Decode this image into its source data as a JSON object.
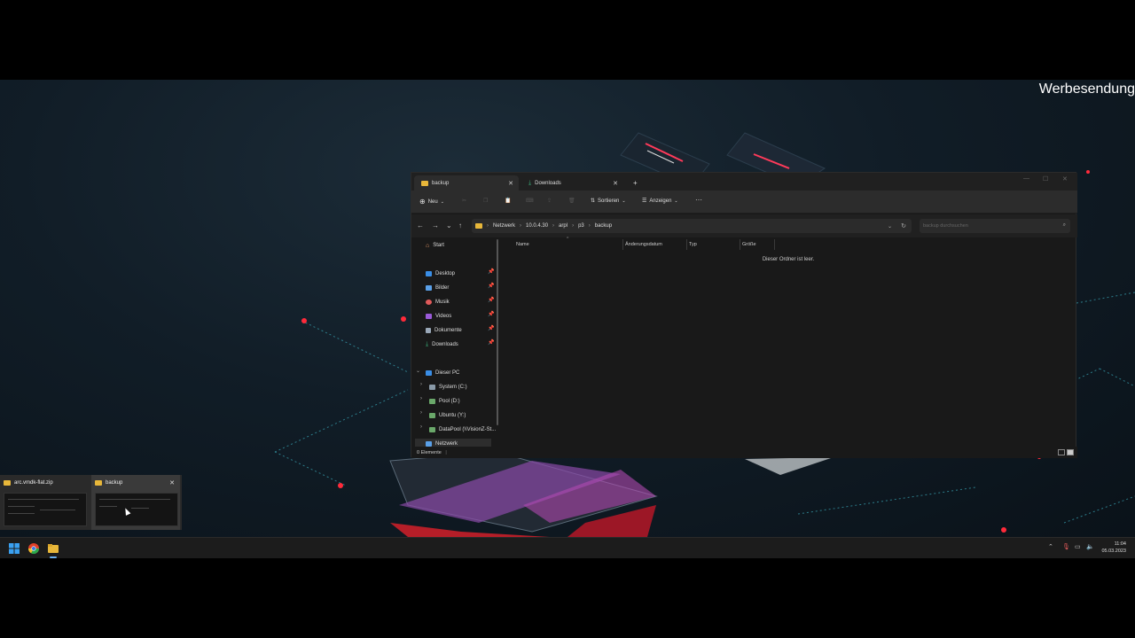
{
  "watermark": "Werbesendung",
  "explorer": {
    "tabs": [
      {
        "label": "backup",
        "icon": "folder-icon"
      },
      {
        "label": "Downloads",
        "icon": "download-icon"
      }
    ],
    "toolbar": {
      "new_label": "Neu",
      "sort_label": "Sortieren",
      "view_label": "Anzeigen",
      "more_label": "···"
    },
    "breadcrumb": [
      "Netzwerk",
      "10.0.4.30",
      "arpl",
      "p3",
      "backup"
    ],
    "search_placeholder": "backup durchsuchen",
    "sidebar": {
      "home": "Start",
      "quick_access": [
        "Desktop",
        "Bilder",
        "Musik",
        "Videos",
        "Dokumente",
        "Downloads"
      ],
      "this_pc": "Dieser PC",
      "drives": [
        "System (C:)",
        "Pool (D:)",
        "Ubuntu (Y:)",
        "DataPool (\\\\VisionZ-St..."
      ],
      "network": "Netzwerk"
    },
    "columns": [
      "Name",
      "Änderungsdatum",
      "Typ",
      "Größe"
    ],
    "empty_message": "Dieser Ordner ist leer.",
    "status": "0 Elemente"
  },
  "thumbnails": [
    {
      "title": "arc.vmdk-flat.zip"
    },
    {
      "title": "backup"
    }
  ],
  "taskbar": {
    "time": "11:04",
    "date": "05.03.2023"
  },
  "colors": {
    "folder": "#e8b73a",
    "accent_red": "#e0202a",
    "desktop_bg": "#111d27"
  }
}
